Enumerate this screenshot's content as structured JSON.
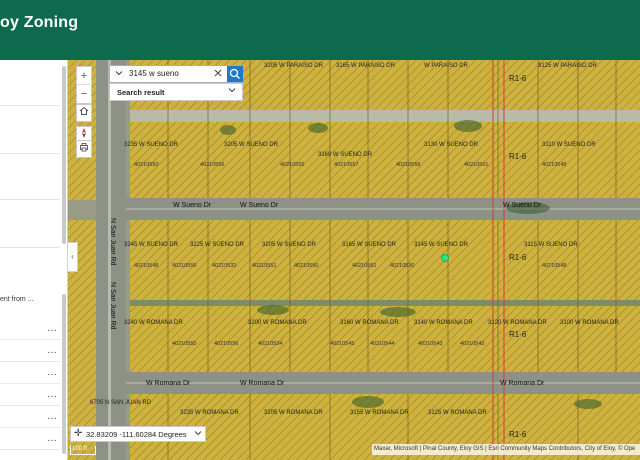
{
  "header": {
    "title": "oy Zoning"
  },
  "panel": {
    "text": "ent from ...",
    "list_ellipsis": [
      "…",
      "…",
      "…",
      "…",
      "…",
      "…",
      "…"
    ]
  },
  "search": {
    "value": "3145 w sueno",
    "result_label": "Search result"
  },
  "map_controls": {
    "zoom_in": "+",
    "zoom_out": "−"
  },
  "coordinates": {
    "text": "32.83209 -111.60284 Degrees"
  },
  "scale": {
    "label": "100 ft"
  },
  "attribution": {
    "text": "Maxar, Microsoft | Pinal County, Eloy GIS | Esri Community Maps Contributors, City of Eloy, © Ope"
  },
  "streets": {
    "w_sueno": "W Sueno Dr",
    "w_romana": "W Romana Dr",
    "n_san_juan": "N San Juan Rd"
  },
  "zone_labels": [
    "R1-6",
    "R1-6",
    "R1-6",
    "R1-6",
    "R1-6"
  ],
  "address_labels": {
    "row1": [
      "3205 W PARAISO DR",
      "3165 W PARAISO DR",
      "W PARAISO DR",
      "3125 W PARAISO DR"
    ],
    "row2": [
      "3235 W SUENO DR",
      "3205 W SUENO DR",
      "3160 W SUENO DR",
      "3130 W SUENO DR",
      "3110 W SUENO DR"
    ],
    "row3": [
      "3245 W SUENO DR",
      "3225 W SUENO DR",
      "3205 W SUENO DR",
      "3165 W SUENO DR",
      "3145 W SUENO DR",
      "3115 W SUENO DR"
    ],
    "row4": [
      "3240 W ROMANA DR",
      "3200 W ROMANA DR",
      "3160 W ROMANA DR",
      "3140 W ROMANA DR",
      "3120 W ROMANA DR",
      "3100 W ROMANA DR"
    ],
    "row5": [
      "6705 N SAN JUAN RD",
      "3235 W ROMANA DR",
      "3205 W ROMANA DR",
      "3155 W ROMANA DR",
      "3125 W ROMANA DR"
    ]
  },
  "parcel_ids": {
    "row2": [
      "40210550",
      "40210556",
      "40210555",
      "40210557",
      "40210558",
      "40210561",
      "40210548"
    ],
    "row3": [
      "40210548",
      "40210556",
      "40210532",
      "40210551",
      "40210550",
      "40210561",
      "40210530",
      "40210548"
    ],
    "row4": [
      "40210555",
      "40210556",
      "40210534",
      "40210545",
      "40210544",
      "40210543",
      "40210542"
    ]
  },
  "colors": {
    "header": "#0e6a4c",
    "parcel_fill": "#d4b438",
    "parcel_hatch": "#7a6a1c",
    "road": "#8e9286",
    "accent_blue": "#1f78c8"
  }
}
